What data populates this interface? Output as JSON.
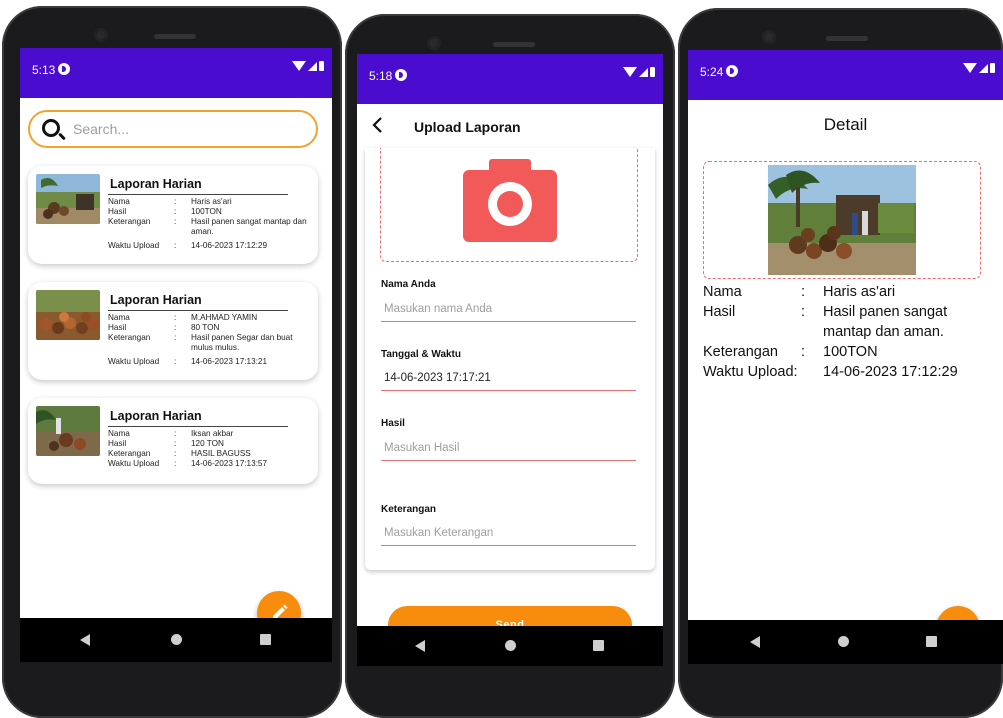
{
  "screens": {
    "list": {
      "time": "5:13",
      "search": {
        "placeholder": "Search..."
      },
      "labels": {
        "nama": "Nama",
        "hasil": "Hasil",
        "keterangan": "Keterangan",
        "waktu": "Waktu Upload",
        "colon": ":"
      },
      "cards": [
        {
          "title": "Laporan Harian",
          "nama": "Haris as'ari",
          "hasil": "100TON",
          "keterangan": "Hasil panen sangat mantap dan aman.",
          "waktu": "14-06-2023 17:12:29"
        },
        {
          "title": "Laporan Harian",
          "nama": "M.AHMAD YAMIN",
          "hasil": "80 TON",
          "keterangan": "Hasil panen Segar dan buat mulus mulus.",
          "waktu": "14-06-2023 17:13:21"
        },
        {
          "title": "Laporan Harian",
          "nama": "Iksan akbar",
          "hasil": "120 TON",
          "keterangan": "HASIL BAGUSS",
          "waktu": "14-06-2023 17:13:57"
        }
      ],
      "fab_icon": "pencil-icon"
    },
    "upload": {
      "time": "5:18",
      "title": "Upload Laporan",
      "camera_icon": "camera-icon",
      "fields": {
        "nama": {
          "label": "Nama Anda",
          "placeholder": "Masukan nama Anda"
        },
        "tanggal": {
          "label": "Tanggal & Waktu",
          "value": "14-06-2023 17:17:21"
        },
        "hasil": {
          "label": "Hasil",
          "placeholder": "Masukan Hasil"
        },
        "keterangan": {
          "label": "Keterangan",
          "placeholder": "Masukan Keterangan"
        }
      },
      "send_label": "Send"
    },
    "detail": {
      "time": "5:24",
      "title": "Detail",
      "labels": {
        "nama": "Nama",
        "hasil": "Hasil",
        "keterangan": "Keterangan",
        "waktu": "Waktu Upload:",
        "colon": ":"
      },
      "values": {
        "nama": "Haris as'ari",
        "hasil": "Hasil panen sangat mantap dan aman.",
        "keterangan": "100TON",
        "waktu": "14-06-2023 17:12:29"
      },
      "fab_icon": "plus-icon",
      "fab_label": "+"
    }
  },
  "colors": {
    "statusbar": "#4a0ccf",
    "accent": "#f88c0d",
    "search_border": "#f2a22f",
    "camera": "#f25a5a",
    "dashed": "#ef6c6c"
  }
}
